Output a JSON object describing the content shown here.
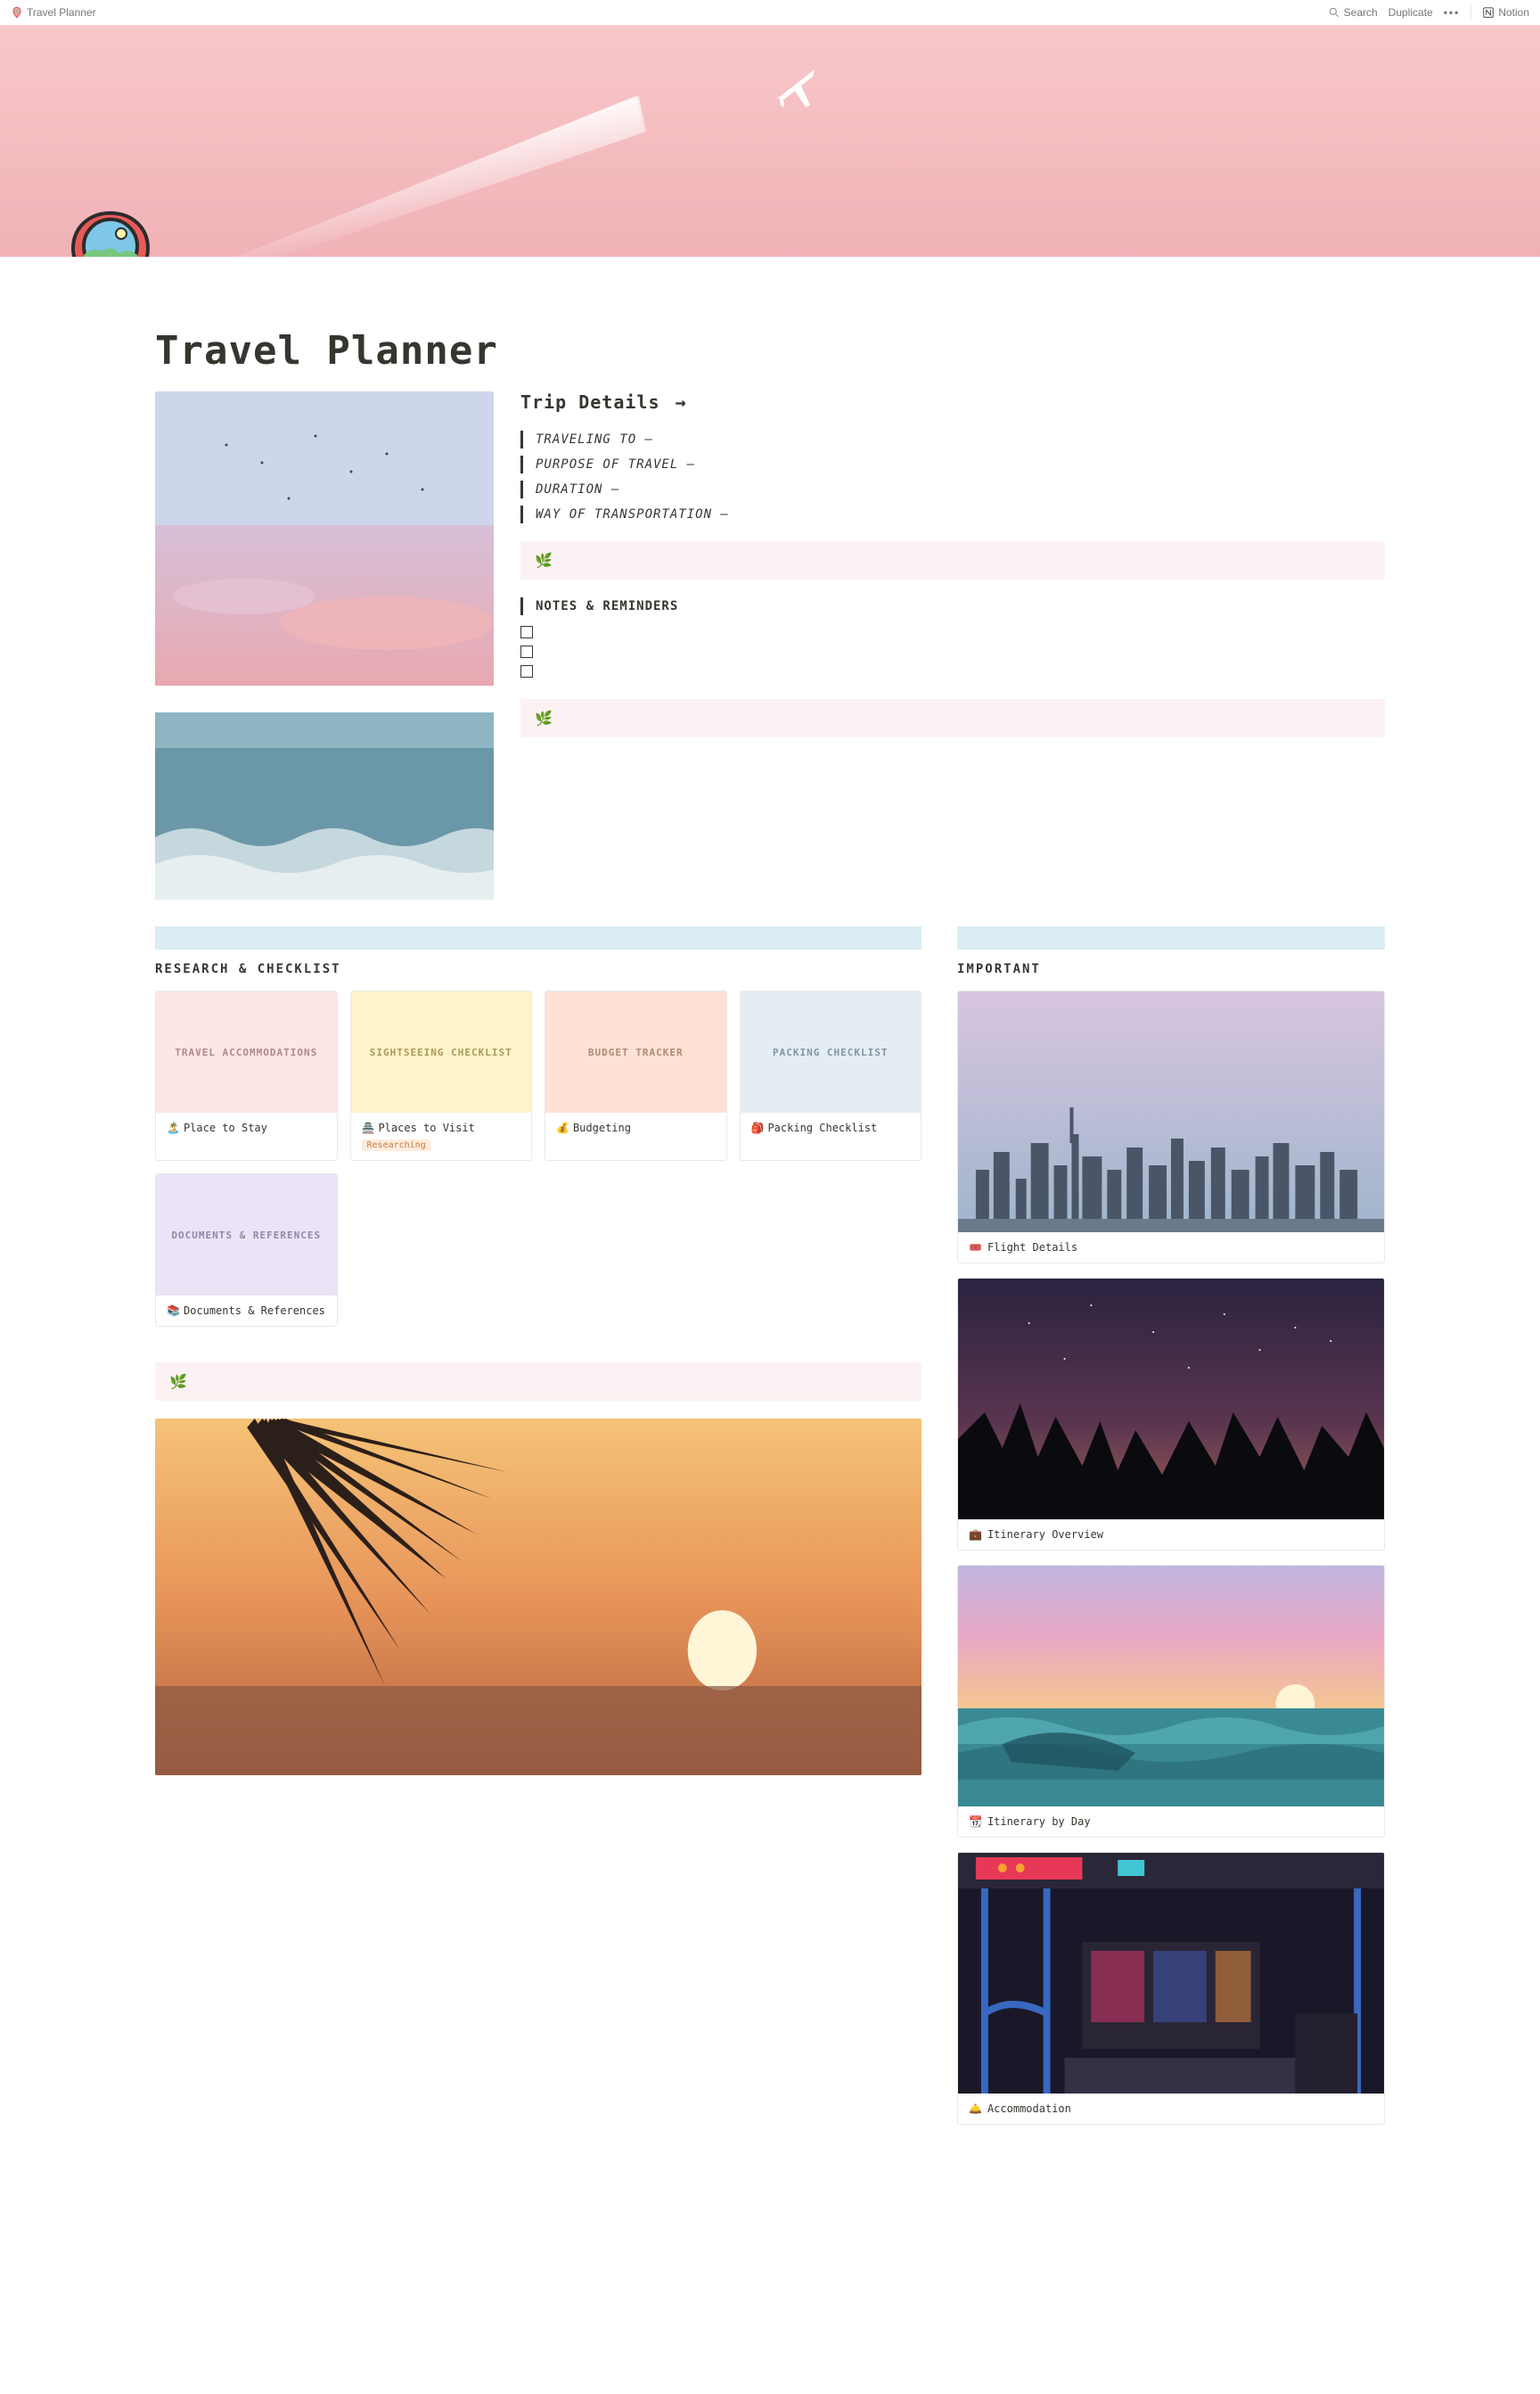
{
  "topbar": {
    "breadcrumb": "Travel Planner",
    "search": "Search",
    "duplicate": "Duplicate",
    "notion": "Notion"
  },
  "page": {
    "title": "Travel Planner"
  },
  "tripDetails": {
    "heading": "Trip Details",
    "fields": [
      "TRAVELING TO —",
      "PURPOSE OF TRAVEL —",
      "DURATION —",
      "WAY OF TRANSPORTATION —"
    ],
    "notesHeading": "NOTES & REMINDERS",
    "callout": "🌿"
  },
  "research": {
    "heading": "RESEARCH & CHECKLIST",
    "cards": [
      {
        "cover": "TRAVEL ACCOMMODATIONS",
        "coverBg": "#fde6e6",
        "coverColor": "#aa8a8a",
        "emoji": "🏝️",
        "title": "Place to Stay",
        "tag": ""
      },
      {
        "cover": "SIGHTSEEING CHECKLIST",
        "coverBg": "#fff3c9",
        "coverColor": "#a99a5f",
        "emoji": "🏯",
        "title": "Places to Visit",
        "tag": "Researching"
      },
      {
        "cover": "BUDGET TRACKER",
        "coverBg": "#fde2d5",
        "coverColor": "#b08a76",
        "emoji": "💰",
        "title": "Budgeting",
        "tag": ""
      },
      {
        "cover": "PACKING CHECKLIST",
        "coverBg": "#e5edf3",
        "coverColor": "#8195a5",
        "emoji": "🎒",
        "title": "Packing Checklist",
        "tag": ""
      },
      {
        "cover": "DOCUMENTS & REFERENCES",
        "coverBg": "#ece3f7",
        "coverColor": "#9487a8",
        "emoji": "📚",
        "title": "Documents & References",
        "tag": ""
      }
    ]
  },
  "important": {
    "heading": "IMPORTANT",
    "cards": [
      {
        "emoji": "🎟️",
        "title": "Flight Details"
      },
      {
        "emoji": "💼",
        "title": "Itinerary Overview"
      },
      {
        "emoji": "📆",
        "title": "Itinerary by Day"
      },
      {
        "emoji": "🛎️",
        "title": "Accommodation"
      }
    ]
  }
}
